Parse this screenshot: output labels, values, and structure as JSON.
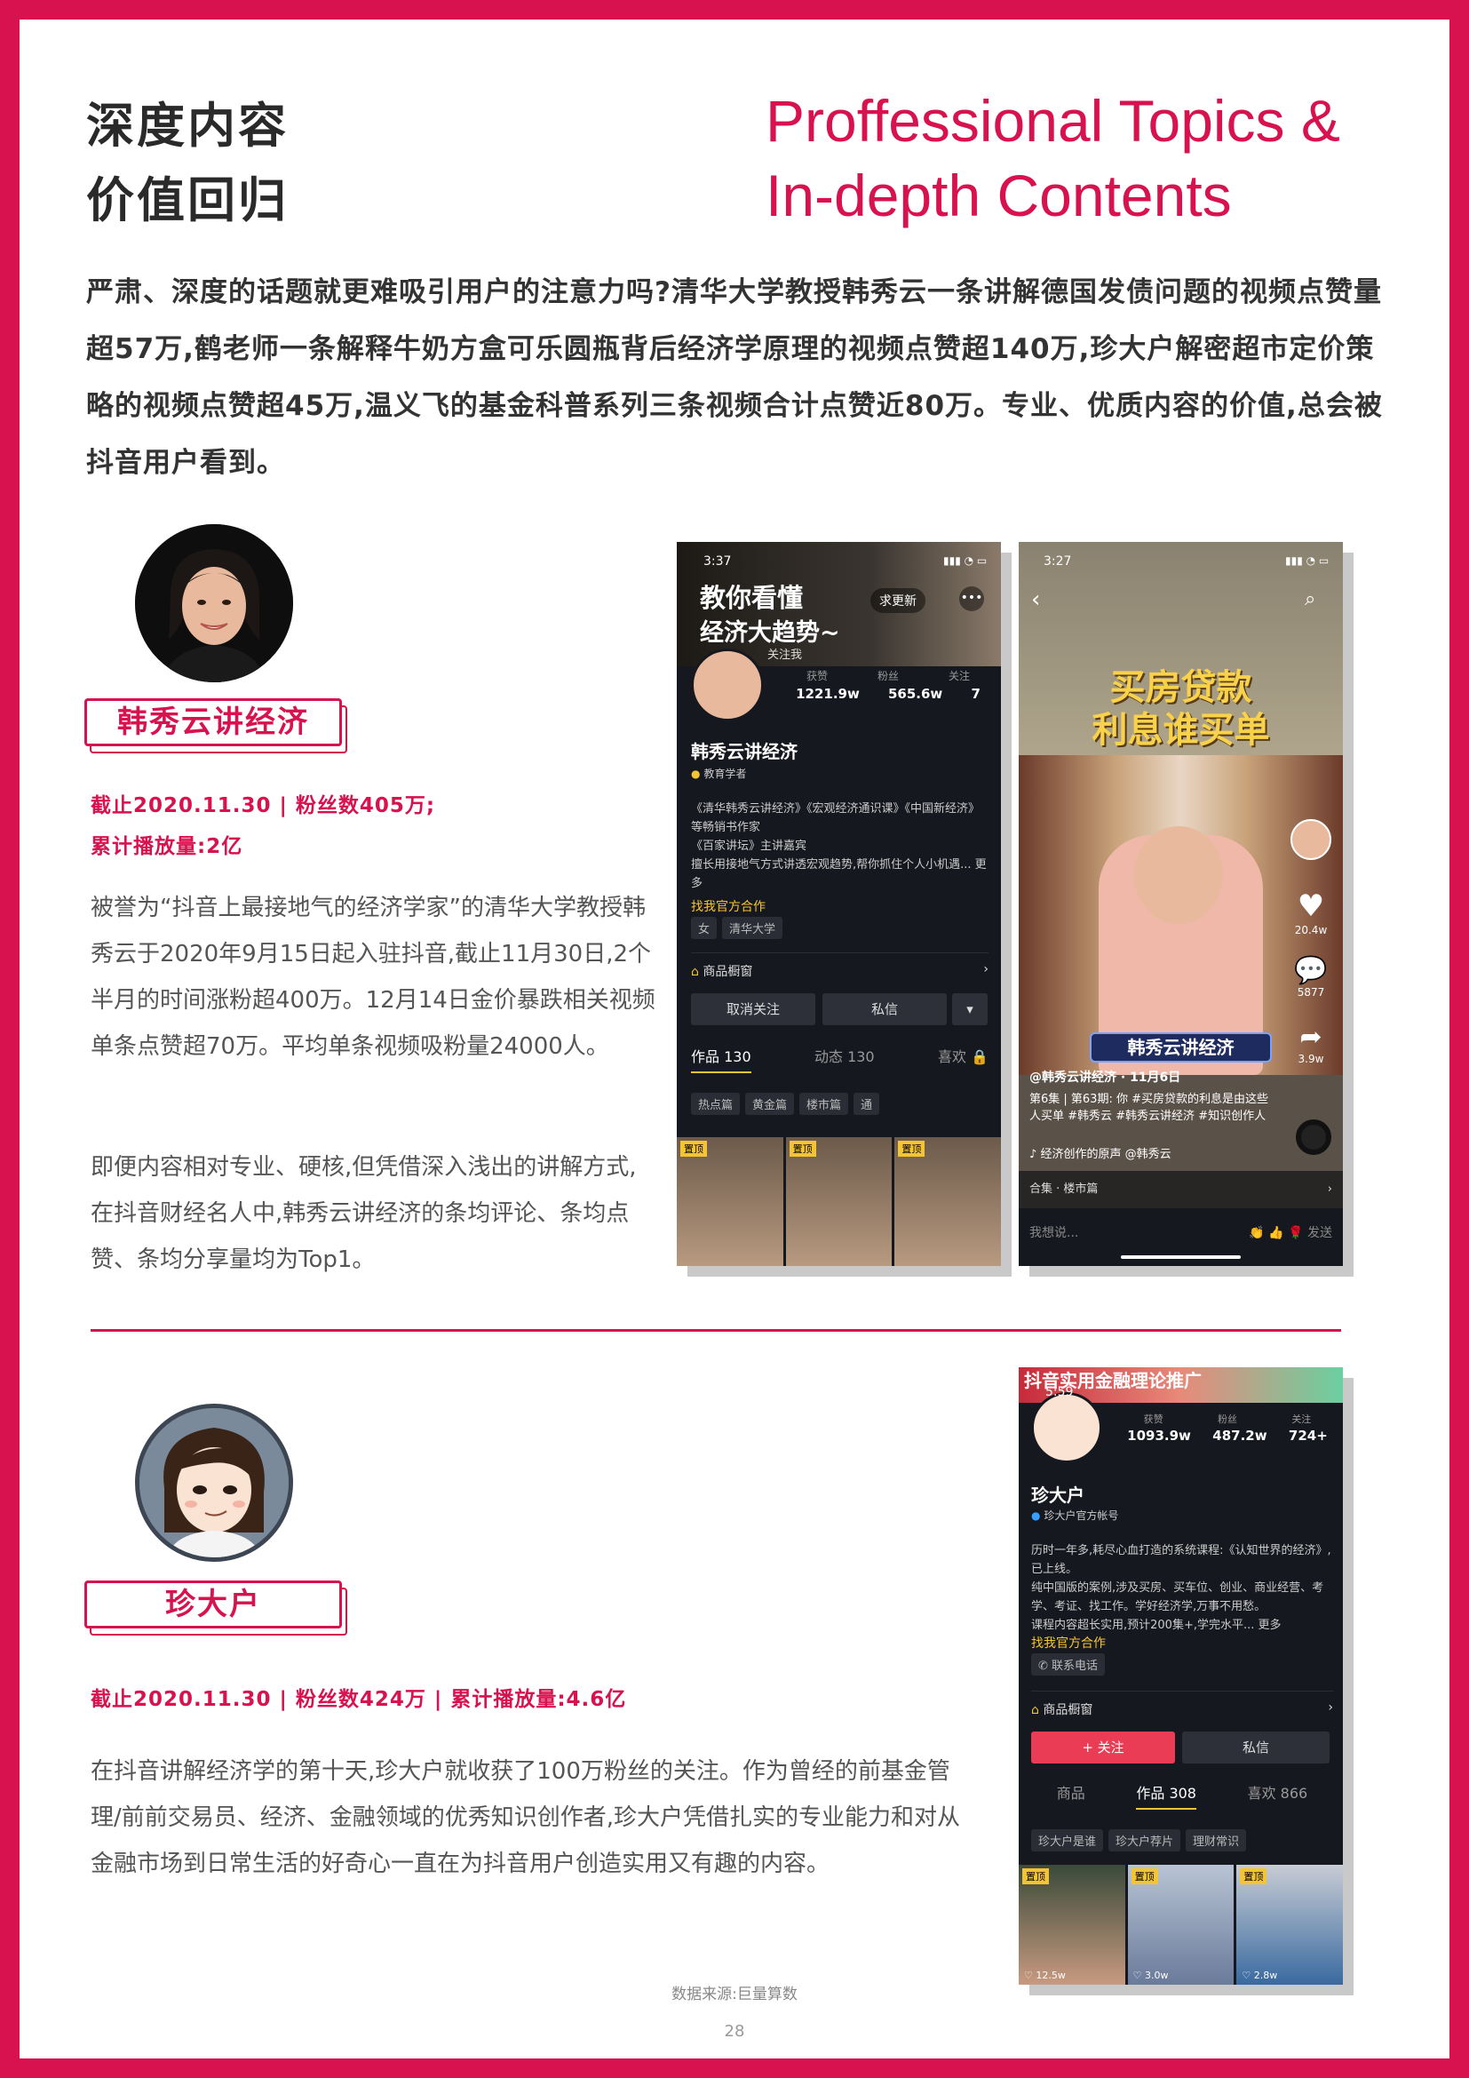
{
  "header": {
    "title_zh_line1": "深度内容",
    "title_zh_line2": "价值回归",
    "title_en_line1": "Proffessional Topics &",
    "title_en_line2": "In-depth Contents"
  },
  "intro": "严肃、深度的话题就更难吸引用户的注意力吗?清华大学教授韩秀云一条讲解德国发债问题的视频点赞量超57万,鹤老师一条解释牛奶方盒可乐圆瓶背后经济学原理的视频点赞超140万,珍大户解密超市定价策略的视频点赞超45万,温义飞的基金科普系列三条视频合计点赞近80万。专业、优质内容的价值,总会被抖音用户看到。",
  "creator1": {
    "name": "韩秀云讲经济",
    "stat_line1": "截止2020.11.30 | 粉丝数405万;",
    "stat_line2": "累计播放量:2亿",
    "para1": "被誉为“抖音上最接地气的经济学家”的清华大学教授韩秀云于2020年9月15日起入驻抖音,截止11月30日,2个半月的时间涨粉超400万。12月14日金价暴跌相关视频单条点赞超70万。平均单条视频吸粉量24000人。",
    "para2": "即便内容相对专业、硬核,但凭借深入浅出的讲解方式,在抖音财经名人中,韩秀云讲经济的条均评论、条均点赞、条均分享量均为Top1。"
  },
  "creator2": {
    "name": "珍大户",
    "stat": "截止2020.11.30 | 粉丝数424万 | 累计播放量:4.6亿",
    "para": "在抖音讲解经济学的第十天,珍大户就收获了100万粉丝的关注。作为曾经的前基金管理/前前交易员、经济、金融领域的优秀知识创作者,珍大户凭借扎实的专业能力和对从金融市场到日常生活的好奇心一直在为抖音用户创造实用又有趣的内容。"
  },
  "screenA": {
    "time": "3:37",
    "banner_l1": "教你看懂",
    "banner_l2": "经济大趋势~",
    "follow_hint": "关注我",
    "update_btn": "求更新",
    "stats_labels": [
      "获赞",
      "粉丝",
      "关注"
    ],
    "stats_values": [
      "1221.9w",
      "565.6w",
      "7"
    ],
    "name": "韩秀云讲经济",
    "badge": "教育学者",
    "bio1": "《清华韩秀云讲经济》《宏观经济通识课》《中国新经济》等畅销书作家",
    "bio2": "《百家讲坛》主讲嘉宾",
    "bio3": "擅长用接地气方式讲透宏观趋势,帮你抓住个人小机遇... 更多",
    "official": "找我官方合作",
    "tags": [
      "女",
      "清华大学"
    ],
    "shop": "商品橱窗",
    "btn_unfollow": "取消关注",
    "btn_msg": "私信",
    "tabs": [
      "作品 130",
      "动态 130",
      "喜欢"
    ],
    "chips": [
      "热点篇",
      "黄金篇",
      "楼市篇",
      "通"
    ],
    "pin": "置顶"
  },
  "screenB": {
    "time": "3:27",
    "caption_l1": "买房贷款",
    "caption_l2": "利息谁买单",
    "likes": "20.4w",
    "comments": "5877",
    "shares": "3.9w",
    "show_name": "韩秀云讲经济",
    "author": "@韩秀云讲经济 · 11月6日",
    "desc": "第6集 | 第63期: 你 #买房贷款的利息是由这些人买单 #韩秀云 #韩秀云讲经济 #知识创作人",
    "music": "经济创作的原声  @韩秀云",
    "collection": "合集 · 楼市篇",
    "input_hint": "我想说...",
    "send": "发送"
  },
  "screenC": {
    "banner": "抖音实用金融理论推广",
    "time": "5:59",
    "stats_labels": [
      "获赞",
      "粉丝",
      "关注"
    ],
    "stats_values": [
      "1093.9w",
      "487.2w",
      "724+"
    ],
    "name": "珍大户",
    "badge": "珍大户官方帐号",
    "bio1": "历时一年多,耗尽心血打造的系统课程:《认知世界的经济》,已上线。",
    "bio2": "纯中国版的案例,涉及买房、买车位、创业、商业经营、考学、考证、找工作。学好经济学,万事不用愁。",
    "bio3": "课程内容超长实用,预计200集+,学完水平... 更多",
    "official": "找我官方合作",
    "contact": "联系电话",
    "shop": "商品橱窗",
    "btn_follow": "+ 关注",
    "btn_msg": "私信",
    "tabs": [
      "商品",
      "作品 308",
      "喜欢 866"
    ],
    "chips": [
      "珍大户是谁",
      "珍大户荐片",
      "理财常识"
    ],
    "pin": "置顶",
    "thumb_likes": [
      "12.5w",
      "3.0w",
      "2.8w"
    ]
  },
  "footer": {
    "source": "数据来源:巨量算数",
    "page": "28"
  },
  "colors": {
    "accent": "#d8114f",
    "dark_screen": "#16181f"
  }
}
